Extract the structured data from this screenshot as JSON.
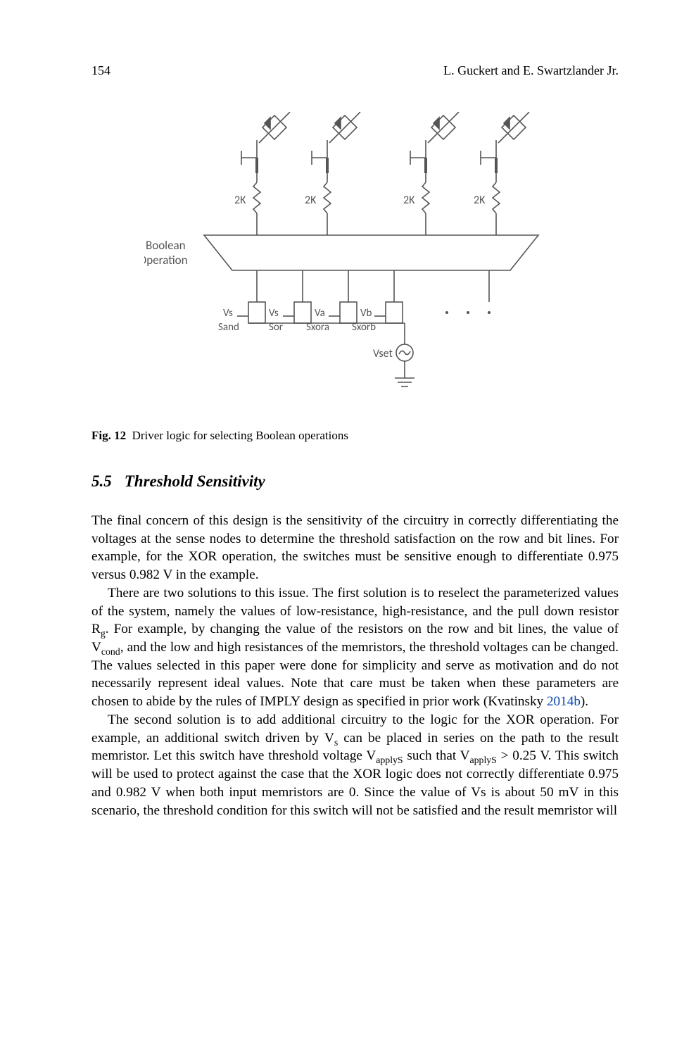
{
  "header": {
    "page_number": "154",
    "authors": "L. Guckert and E. Swartzlander Jr."
  },
  "figure": {
    "labels": {
      "boolean": "Boolean",
      "operation": "Operation",
      "r_values": [
        "2K",
        "2K",
        "2K",
        "2K"
      ],
      "vs1_top": "Vs",
      "vs1_bot": "Sand",
      "vs2_top": "Vs",
      "vs2_bot": "Sor",
      "va_top": "Va",
      "va_bot": "Sxora",
      "vb_top": "Vb",
      "vb_bot": "Sxorb",
      "vset": "Vset"
    }
  },
  "caption": {
    "label": "Fig. 12",
    "text": "Driver logic for selecting Boolean operations"
  },
  "section": {
    "number": "5.5",
    "title": "Threshold Sensitivity"
  },
  "paragraphs": {
    "p1_a": "The final concern of this design is the sensitivity of the circuitry in correctly differentiating the voltages at the sense nodes to determine the threshold satisfaction on the row and bit lines. For example, for the XOR operation, the switches must be sensitive enough to differentiate 0.975 versus 0.982 V in the example.",
    "p2_a": "There are two solutions to this issue. The first solution is to reselect the parameterized values of the system, namely the values of low-resistance, high-resistance, and the pull down resistor R",
    "p2_sub1": "g",
    "p2_b": ". For example, by changing the value of the resistors on the row and bit lines, the value of V",
    "p2_sub2": "cond",
    "p2_c": ", and the low and high resistances of the memristors, the threshold voltages can be changed. The values selected in this paper were done for simplicity and serve as motivation and do not necessarily represent ideal values. Note that care must be taken when these parameters are chosen to abide by the rules of IMPLY design as specified in prior work (Kvatinsky ",
    "p2_year": "2014b",
    "p2_d": ").",
    "p3_a": "The second solution is to add additional circuitry to the logic for the XOR operation. For example, an additional switch driven by V",
    "p3_sub1": "s",
    "p3_b": " can be placed in series on the path to the result memristor. Let this switch have threshold voltage V",
    "p3_sub2": "applyS",
    "p3_c": " such that V",
    "p3_sub3": "applyS",
    "p3_d": " > 0.25 V. This switch will be used to protect against the case that the XOR logic does not correctly differentiate 0.975 and 0.982 V when both input memristors are 0. Since the value of Vs is about 50 mV in this scenario, the threshold condition for this switch will not be satisfied and the result memristor will"
  }
}
